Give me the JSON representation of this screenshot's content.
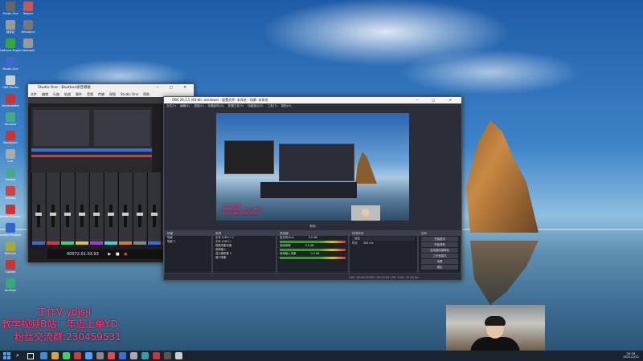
{
  "desktop": {
    "icons": [
      {
        "label": "Studio One"
      },
      {
        "label": "回收站"
      },
      {
        "label": "GeForce Experience"
      },
      {
        "label": "Studio One"
      },
      {
        "label": "OBS Studio"
      },
      {
        "label": "Voicemeeter"
      },
      {
        "label": "Vocaloid"
      },
      {
        "label": "Bandicam"
      },
      {
        "label": "Live"
      },
      {
        "label": "Realtek"
      },
      {
        "label": "Kontakt"
      },
      {
        "label": "Adobe Premiere"
      },
      {
        "label": "Adobe Photoshop"
      },
      {
        "label": "Gianhyn"
      },
      {
        "label": "Cubase"
      },
      {
        "label": "Audition"
      },
      {
        "label": "Reaper"
      },
      {
        "label": "Melodyne"
      },
      {
        "label": "Cakewalk"
      }
    ]
  },
  "studio_one": {
    "title": "Studio One - Beatbox录音模板",
    "menu": [
      "文件",
      "编辑",
      "乐曲",
      "轨道",
      "事件",
      "音频",
      "传输",
      "视图",
      "Studio One",
      "帮助"
    ],
    "transport_time": "00072.01.03.93",
    "colors": {
      "accent": "#3a6fd8"
    }
  },
  "obs": {
    "title": "OBS 26.1.1 (64-bit, windows) - 配置文件: 未命名 - 场景: 未命名",
    "menu": [
      "文件(F)",
      "编辑(E)",
      "视图(V)",
      "停靠部件(D)",
      "配置文件(P)",
      "场景集合(S)",
      "工具(T)",
      "帮助(H)"
    ],
    "overlay_small": {
      "line1": "工作V ydjsjl",
      "line2": "教学视频B站：年迈上单YD",
      "line3": "粉丝交流群:230459531"
    },
    "docks": {
      "scenes": {
        "title": "场景",
        "items": [
          "场景",
          "场景 2"
        ]
      },
      "sources": {
        "title": "来源",
        "items": [
          "文本 (GDI+) 2",
          "文本 (GDI+)",
          "视频采集设备",
          "音频输入",
          "显示器采集 2",
          "窗口采集"
        ]
      },
      "mixer": {
        "title": "混音器",
        "channels": [
          {
            "name": "麦克风/Aux",
            "db": "0.0 dB"
          },
          {
            "name": "桌面音频",
            "db": "0.0 dB"
          },
          {
            "name": "音频输入采集",
            "db": "0.0 dB"
          }
        ]
      },
      "transitions": {
        "title": "转场特效",
        "type": "淡出",
        "duration_label": "时长",
        "duration": "300 ms"
      },
      "controls": {
        "title": "控件",
        "buttons": [
          "开始推流",
          "开始录制",
          "启动虚拟摄像机",
          "工作室模式",
          "设置",
          "退出"
        ]
      }
    },
    "studio_mode_label": "转场",
    "status": "LIVE: 00:00:00   REC: 00:00:00   CPU: 3.4%, 30.00 fps"
  },
  "overlay": {
    "line1": "工作V ydjsjl",
    "line2": "教学视频B站：年迈上单YD",
    "line3": "粉丝交流群:230459531",
    "color": "#ff3d7f"
  },
  "taskbar": {
    "clock_time": "20:18",
    "clock_date": "2021/1/12"
  }
}
